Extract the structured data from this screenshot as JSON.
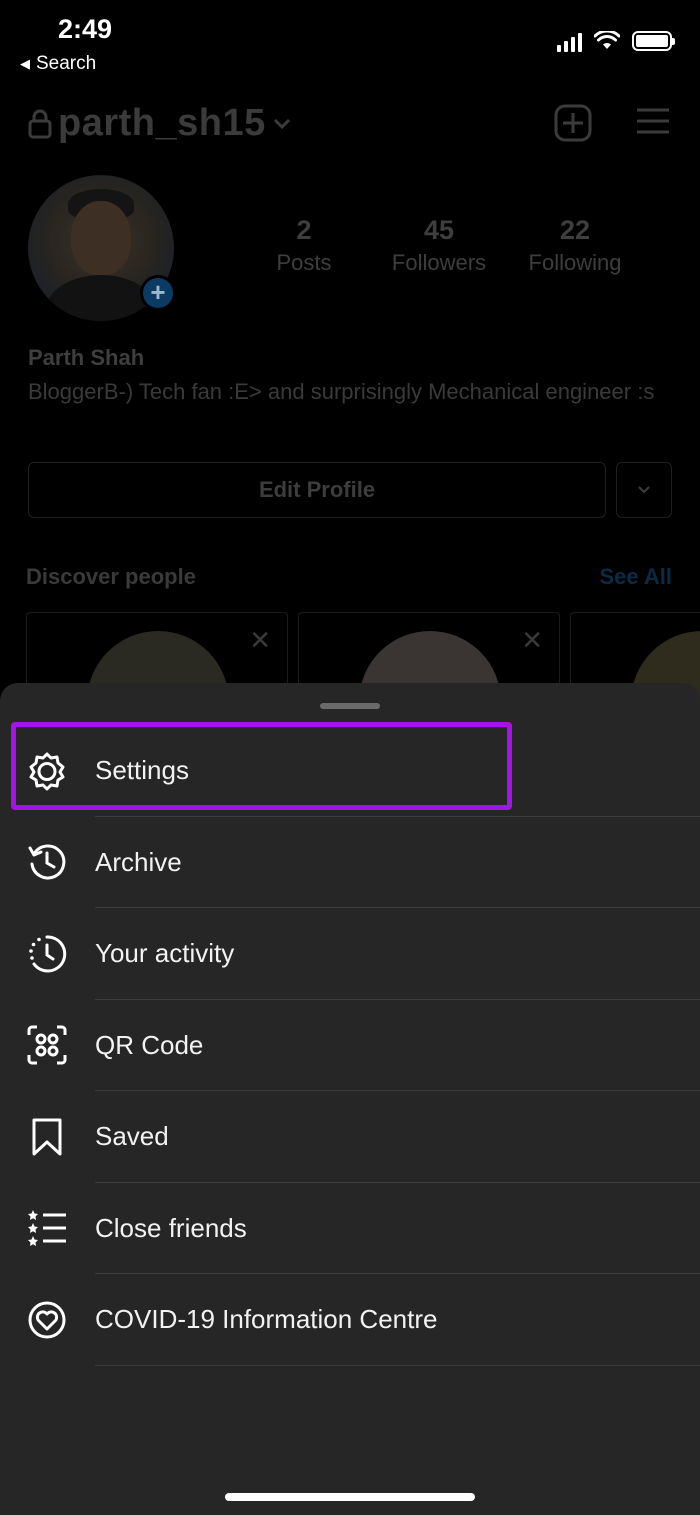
{
  "status_bar": {
    "time": "2:49",
    "back_label": "Search"
  },
  "profile": {
    "username": "parth_sh15",
    "stats": [
      {
        "num": "2",
        "label": "Posts"
      },
      {
        "num": "45",
        "label": "Followers"
      },
      {
        "num": "22",
        "label": "Following"
      }
    ],
    "display_name": "Parth Shah",
    "bio": "BloggerB-) Tech fan :E> and surprisingly Mechanical engineer :s",
    "edit_profile_label": "Edit Profile",
    "discover_title": "Discover people",
    "see_all_label": "See All"
  },
  "sheet": {
    "items": [
      {
        "label": "Settings",
        "icon": "settings-gear-icon"
      },
      {
        "label": "Archive",
        "icon": "archive-history-icon"
      },
      {
        "label": "Your activity",
        "icon": "activity-clock-icon"
      },
      {
        "label": "QR Code",
        "icon": "qr-code-icon"
      },
      {
        "label": "Saved",
        "icon": "bookmark-icon"
      },
      {
        "label": "Close friends",
        "icon": "close-friends-list-icon"
      },
      {
        "label": "COVID-19 Information Centre",
        "icon": "covid-heart-icon"
      }
    ]
  },
  "colors": {
    "highlight": "#a414e6",
    "sheet_bg": "#262626",
    "background": "#000000"
  }
}
